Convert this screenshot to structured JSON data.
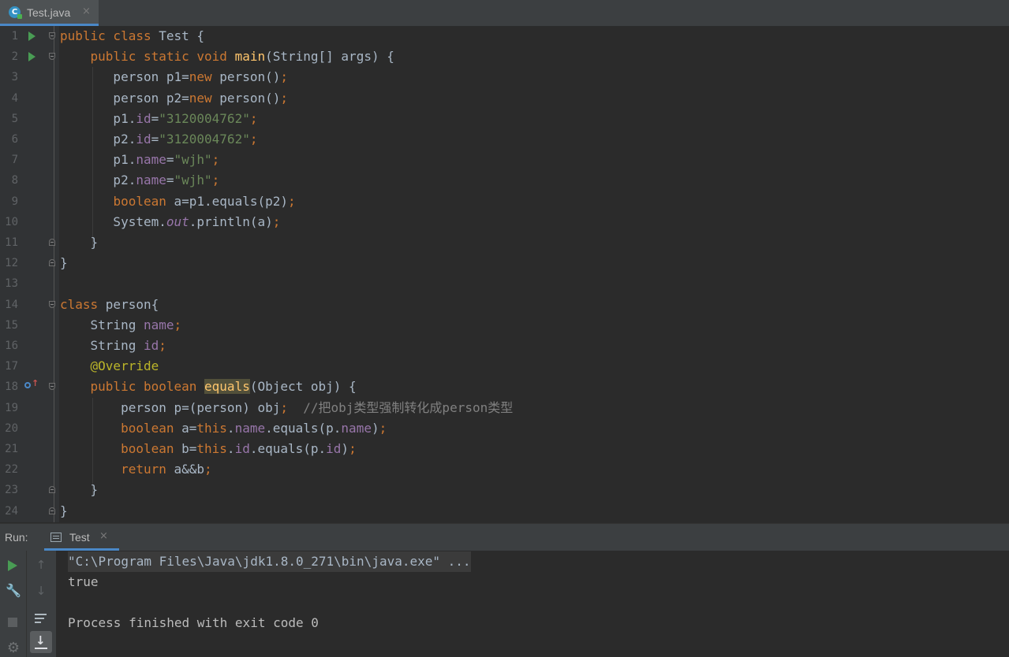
{
  "editor_tab": {
    "filename": "Test.java",
    "close_glyph": "×",
    "file_icon_letter": "C"
  },
  "code_lines": [
    {
      "n": "1",
      "tokens": [
        [
          "kw",
          "public class "
        ],
        [
          "",
          "Test {"
        ]
      ]
    },
    {
      "n": "2",
      "tokens": [
        [
          "",
          "    "
        ],
        [
          "kw",
          "public static void "
        ],
        [
          "fn",
          "main"
        ],
        [
          "",
          "(String[] args) {"
        ]
      ]
    },
    {
      "n": "3",
      "tokens": [
        [
          "",
          "       person p1="
        ],
        [
          "kw",
          "new "
        ],
        [
          "",
          "person()"
        ],
        [
          "kw",
          ";"
        ]
      ]
    },
    {
      "n": "4",
      "tokens": [
        [
          "",
          "       person p2="
        ],
        [
          "kw",
          "new "
        ],
        [
          "",
          "person()"
        ],
        [
          "kw",
          ";"
        ]
      ]
    },
    {
      "n": "5",
      "tokens": [
        [
          "",
          "       p1."
        ],
        [
          "fld",
          "id"
        ],
        [
          "",
          "="
        ],
        [
          "str",
          "\"3120004762\""
        ],
        [
          "kw",
          ";"
        ]
      ]
    },
    {
      "n": "6",
      "tokens": [
        [
          "",
          "       p2."
        ],
        [
          "fld",
          "id"
        ],
        [
          "",
          "="
        ],
        [
          "str",
          "\"3120004762\""
        ],
        [
          "kw",
          ";"
        ]
      ]
    },
    {
      "n": "7",
      "tokens": [
        [
          "",
          "       p1."
        ],
        [
          "fld",
          "name"
        ],
        [
          "",
          "="
        ],
        [
          "str",
          "\"wjh\""
        ],
        [
          "kw",
          ";"
        ]
      ]
    },
    {
      "n": "8",
      "tokens": [
        [
          "",
          "       p2."
        ],
        [
          "fld",
          "name"
        ],
        [
          "",
          "="
        ],
        [
          "str",
          "\"wjh\""
        ],
        [
          "kw",
          ";"
        ]
      ]
    },
    {
      "n": "9",
      "tokens": [
        [
          "",
          "       "
        ],
        [
          "kw",
          "boolean "
        ],
        [
          "",
          "a=p1.equals(p2)"
        ],
        [
          "kw",
          ";"
        ]
      ]
    },
    {
      "n": "10",
      "tokens": [
        [
          "",
          "       System."
        ],
        [
          "ital",
          "out"
        ],
        [
          "",
          ".println(a)"
        ],
        [
          "kw",
          ";"
        ]
      ]
    },
    {
      "n": "11",
      "tokens": [
        [
          "",
          "    }"
        ]
      ]
    },
    {
      "n": "12",
      "tokens": [
        [
          "",
          "}"
        ]
      ]
    },
    {
      "n": "13",
      "tokens": []
    },
    {
      "n": "14",
      "tokens": [
        [
          "kw",
          "class "
        ],
        [
          "",
          "person{"
        ]
      ]
    },
    {
      "n": "15",
      "tokens": [
        [
          "",
          "    String "
        ],
        [
          "fld",
          "name"
        ],
        [
          "kw",
          ";"
        ]
      ]
    },
    {
      "n": "16",
      "tokens": [
        [
          "",
          "    String "
        ],
        [
          "fld",
          "id"
        ],
        [
          "kw",
          ";"
        ]
      ]
    },
    {
      "n": "17",
      "tokens": [
        [
          "",
          "    "
        ],
        [
          "ann",
          "@Override"
        ]
      ]
    },
    {
      "n": "18",
      "tokens": [
        [
          "",
          "    "
        ],
        [
          "kw",
          "public boolean "
        ],
        [
          "fn hl",
          "equals"
        ],
        [
          "",
          "(Object obj) {"
        ]
      ]
    },
    {
      "n": "19",
      "tokens": [
        [
          "",
          "        person p=(person) obj"
        ],
        [
          "kw",
          ";"
        ],
        [
          "",
          "  "
        ],
        [
          "cmt",
          "//把obj类型强制转化成person类型"
        ]
      ]
    },
    {
      "n": "20",
      "tokens": [
        [
          "",
          "        "
        ],
        [
          "kw",
          "boolean "
        ],
        [
          "",
          "a="
        ],
        [
          "kw",
          "this"
        ],
        [
          "",
          "."
        ],
        [
          "fld",
          "name"
        ],
        [
          "",
          ".equals(p."
        ],
        [
          "fld",
          "name"
        ],
        [
          "",
          ")"
        ],
        [
          "kw",
          ";"
        ]
      ]
    },
    {
      "n": "21",
      "tokens": [
        [
          "",
          "        "
        ],
        [
          "kw",
          "boolean "
        ],
        [
          "",
          "b="
        ],
        [
          "kw",
          "this"
        ],
        [
          "",
          "."
        ],
        [
          "fld",
          "id"
        ],
        [
          "",
          ".equals(p."
        ],
        [
          "fld",
          "id"
        ],
        [
          "",
          ")"
        ],
        [
          "kw",
          ";"
        ]
      ]
    },
    {
      "n": "22",
      "tokens": [
        [
          "",
          "        "
        ],
        [
          "kw",
          "return "
        ],
        [
          "",
          "a&&b"
        ],
        [
          "kw",
          ";"
        ]
      ]
    },
    {
      "n": "23",
      "tokens": [
        [
          "",
          "    }"
        ]
      ]
    },
    {
      "n": "24",
      "tokens": [
        [
          "",
          "}"
        ]
      ]
    }
  ],
  "gutter_markers": {
    "run_lines": [
      "1",
      "2"
    ],
    "override_lines": [
      "18"
    ],
    "fold_down_lines": [
      "1",
      "2",
      "14",
      "18"
    ],
    "fold_up_lines": [
      "11",
      "12",
      "23",
      "24"
    ]
  },
  "run_panel": {
    "label": "Run:",
    "tab_name": "Test",
    "close_glyph": "×",
    "toolbar_icons": [
      "rerun-icon",
      "wrench-icon",
      "stop-icon",
      "settings-icon",
      "scroll-up-icon",
      "scroll-down-icon",
      "soft-wrap-icon",
      "scroll-to-end-icon"
    ]
  },
  "console": {
    "command": "\"C:\\Program Files\\Java\\jdk1.8.0_271\\bin\\java.exe\" ...",
    "output": "true",
    "blank": "",
    "exit_message": "Process finished with exit code 0"
  },
  "colors": {
    "keyword": "#cc7832",
    "method": "#ffc66d",
    "string": "#6a8759",
    "field": "#9876aa",
    "annotation": "#bbb529",
    "comment": "#808080",
    "background": "#2b2b2b",
    "accent": "#4a88c7"
  }
}
